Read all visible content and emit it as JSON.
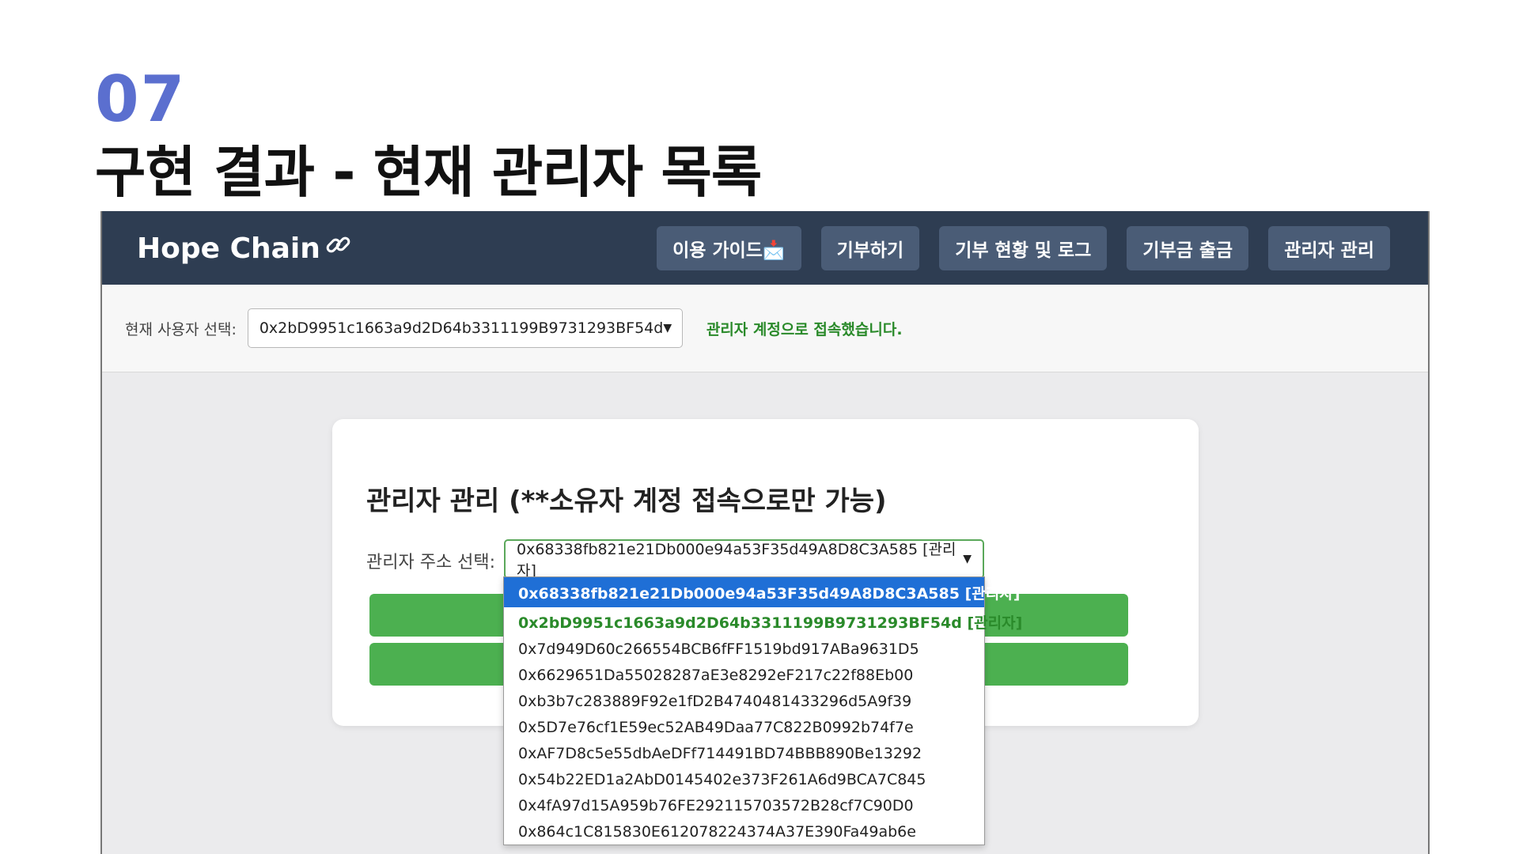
{
  "slide": {
    "number": "07",
    "title": "구현 결과 - 현재 관리자 목록"
  },
  "navbar": {
    "brand": "Hope Chain",
    "brand_icon": "link-icon",
    "buttons": [
      "이용 가이드📩",
      "기부하기",
      "기부 현황 및 로그",
      "기부금 출금",
      "관리자 관리"
    ]
  },
  "user_bar": {
    "label": "현재 사용자 선택:",
    "selected": "0x2bD9951c1663a9d2D64b3311199B9731293BF54d",
    "status": "관리자 계정으로 접속했습니다."
  },
  "admin_card": {
    "title": "관리자 관리 (**소유자 계정 접속으로만 가능)",
    "select_label": "관리자 주소 선택:",
    "selected": "0x68338fb821e21Db000e94a53F35d49A8D8C3A585 [관리자]",
    "options": [
      "0x68338fb821e21Db000e94a53F35d49A8D8C3A585 [관리자]",
      "0x2bD9951c1663a9d2D64b3311199B9731293BF54d [관리자]",
      "0x7d949D60c266554BCB6fFF1519bd917ABa9631D5",
      "0x6629651Da55028287aE3e8292eF217c22f88Eb00",
      "0xb3b7c283889F92e1fD2B4740481433296d5A9f39",
      "0x5D7e76cf1E59ec52AB49Daa77C822B0992b74f7e",
      "0xAF7D8c5e55dbAeDFf714491BD74BBB890Be13292",
      "0x54b22ED1a2AbD0145402e373F261A6d9BCA7C845",
      "0x4fA97d15A959b76FE292115703572B28cf7C90D0",
      "0x864c1C815830E612078224374A37E390Fa49ab6e"
    ]
  },
  "colors": {
    "accent": "#5b6fcf",
    "navbar": "#2e3d52",
    "button_green": "#4cb050",
    "status_green": "#2a8a2a",
    "selected_blue": "#1f6fd6"
  }
}
